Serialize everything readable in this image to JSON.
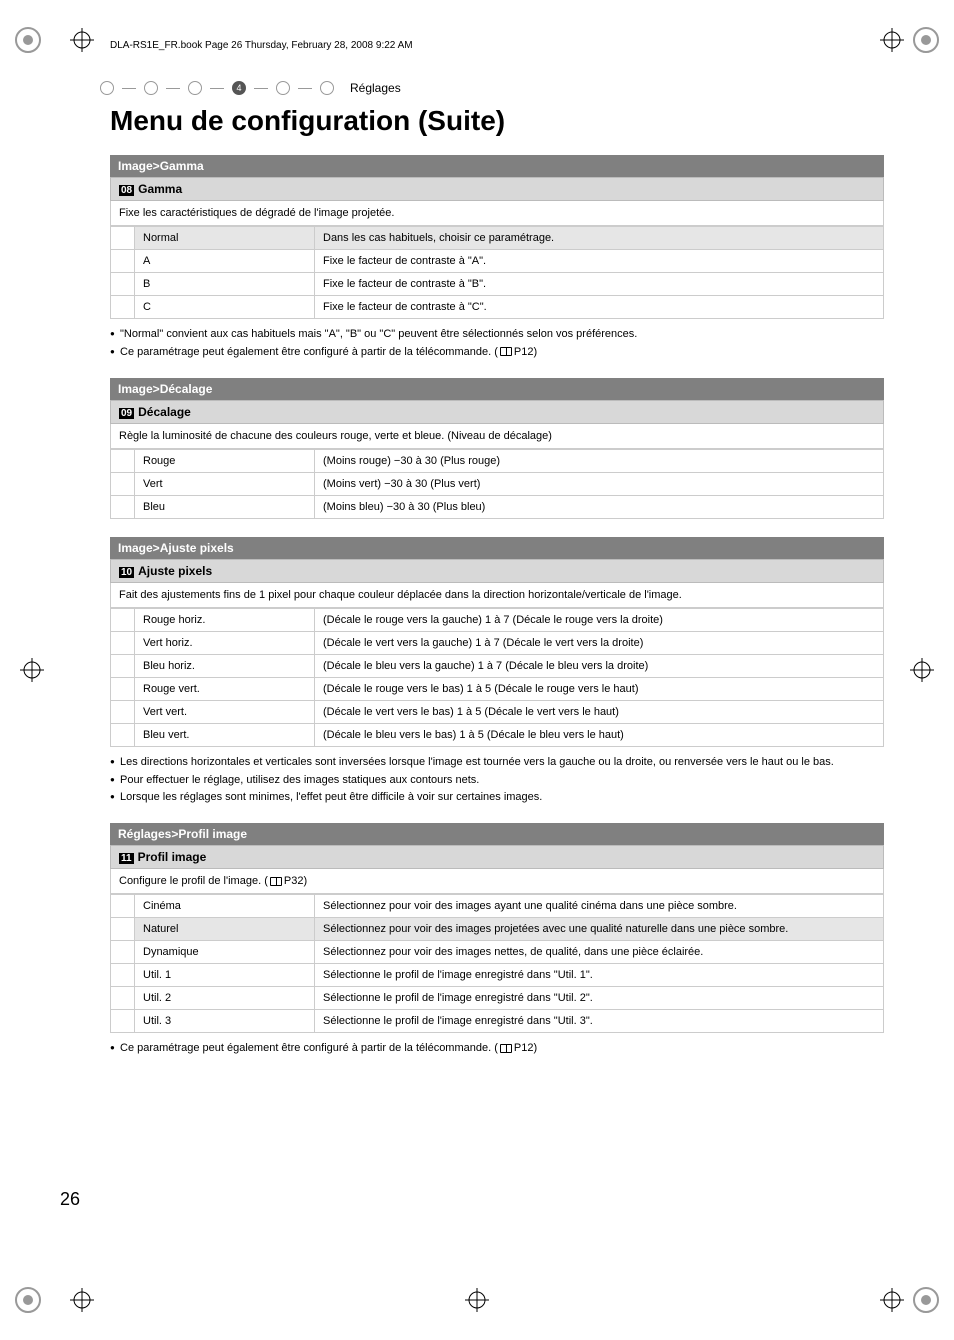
{
  "header_line": "DLA-RS1E_FR.book  Page 26  Thursday, February 28, 2008  9:22 AM",
  "nav": {
    "active_index": "4",
    "label": "Réglages"
  },
  "title": "Menu de configuration (Suite)",
  "gamma": {
    "header": "Image>Gamma",
    "sub_num": "08",
    "sub_label": "Gamma",
    "desc": "Fixe les caractéristiques de dégradé de l'image projetée.",
    "rows": [
      {
        "name": "Normal",
        "desc": "Dans les cas habituels, choisir ce paramétrage.",
        "highlight": true
      },
      {
        "name": "A",
        "desc": "Fixe le facteur de contraste à \"A\"."
      },
      {
        "name": "B",
        "desc": "Fixe le facteur de contraste à \"B\"."
      },
      {
        "name": "C",
        "desc": "Fixe le facteur de contraste à \"C\"."
      }
    ],
    "notes": [
      "\"Normal\" convient aux cas habituels mais \"A\", \"B\" ou \"C\" peuvent être sélectionnés selon vos préférences.",
      "Ce paramétrage peut également être configuré à partir de la télécommande. "
    ],
    "note_ref": "P12"
  },
  "decalage": {
    "header": "Image>Décalage",
    "sub_num": "09",
    "sub_label": "Décalage",
    "desc": "Règle la luminosité de chacune des couleurs rouge, verte et bleue. (Niveau de décalage)",
    "rows": [
      {
        "name": "Rouge",
        "desc": "(Moins rouge) −30 à 30 (Plus rouge)"
      },
      {
        "name": "Vert",
        "desc": "(Moins vert) −30 à 30 (Plus vert)"
      },
      {
        "name": "Bleu",
        "desc": "(Moins bleu) −30 à 30 (Plus bleu)"
      }
    ]
  },
  "ajuste": {
    "header": "Image>Ajuste pixels",
    "sub_num": "10",
    "sub_label": "Ajuste pixels",
    "desc": "Fait des ajustements fins de 1 pixel pour chaque couleur déplacée dans la direction horizontale/verticale de l'image.",
    "rows": [
      {
        "name": "Rouge horiz.",
        "desc": "(Décale le rouge vers la gauche) 1 à 7 (Décale le rouge vers la droite)"
      },
      {
        "name": "Vert horiz.",
        "desc": "(Décale le vert vers la gauche) 1 à 7 (Décale le vert vers la droite)"
      },
      {
        "name": "Bleu horiz.",
        "desc": "(Décale le bleu vers la gauche) 1 à 7 (Décale le bleu vers la droite)"
      },
      {
        "name": "Rouge vert.",
        "desc": "(Décale le rouge vers le bas) 1 à 5 (Décale le rouge vers le haut)"
      },
      {
        "name": "Vert vert.",
        "desc": "(Décale le vert vers le bas) 1 à 5 (Décale le vert vers le haut)"
      },
      {
        "name": "Bleu vert.",
        "desc": "(Décale le bleu vers le bas) 1 à 5 (Décale le bleu vers le haut)"
      }
    ],
    "notes": [
      "Les directions horizontales et verticales sont inversées lorsque l'image est tournée vers la gauche ou la droite, ou renversée vers le haut ou le bas.",
      "Pour effectuer le réglage, utilisez des images statiques aux contours nets.",
      "Lorsque les réglages sont minimes, l'effet peut être difficile à voir sur certaines images."
    ]
  },
  "profil": {
    "header": "Réglages>Profil image",
    "sub_num": "11",
    "sub_label": "Profil image",
    "desc_prefix": "Configure le profil de l'image. ",
    "desc_ref": "P32",
    "rows": [
      {
        "name": "Cinéma",
        "desc": "Sélectionnez pour voir des images ayant une qualité cinéma dans une pièce sombre."
      },
      {
        "name": "Naturel",
        "desc": "Sélectionnez pour voir des images projetées avec une qualité naturelle dans une pièce sombre.",
        "highlight": true
      },
      {
        "name": "Dynamique",
        "desc": "Sélectionnez pour voir des images nettes, de qualité, dans une pièce éclairée."
      },
      {
        "name": "Util. 1",
        "desc": "Sélectionne le profil de l'image enregistré dans \"Util. 1\"."
      },
      {
        "name": "Util. 2",
        "desc": "Sélectionne le profil de l'image enregistré dans \"Util. 2\"."
      },
      {
        "name": "Util. 3",
        "desc": "Sélectionne le profil de l'image enregistré dans \"Util. 3\"."
      }
    ],
    "notes": [
      "Ce paramétrage peut également être configuré à partir de la télécommande. "
    ],
    "note_ref": "P12"
  },
  "page_number": "26"
}
